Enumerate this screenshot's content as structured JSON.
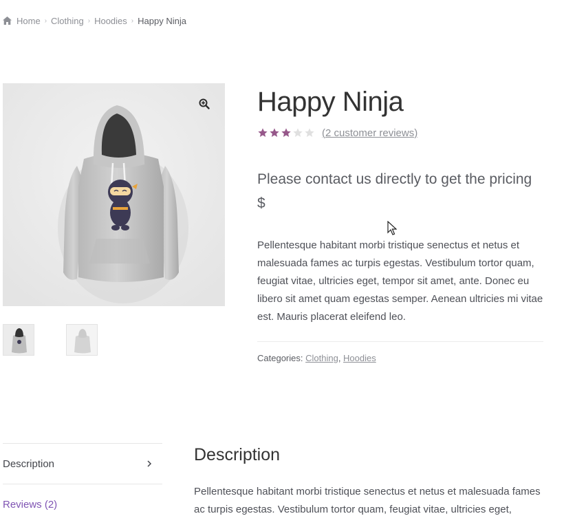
{
  "breadcrumb": {
    "home_icon": "home-icon",
    "items": [
      "Home",
      "Clothing",
      "Hoodies"
    ],
    "current": "Happy Ninja",
    "separator": "›"
  },
  "gallery": {
    "main_image_alt": "Happy Ninja hoodie",
    "zoom_icon": "zoom-icon",
    "thumbnails": [
      "hoodie-front-thumb",
      "hoodie-back-thumb"
    ]
  },
  "product": {
    "title": "Happy Ninja",
    "rating": 3,
    "rating_max": 5,
    "review_link": "(2 customer reviews)",
    "price_note": "Please contact us directly to get the pricing",
    "currency_symbol": "$",
    "short_description": "Pellentesque habitant morbi tristique senectus et netus et malesuada fames ac turpis egestas. Vestibulum tortor quam, feugiat vitae, ultricies eget, tempor sit amet, ante. Donec eu libero sit amet quam egestas semper. Aenean ultricies mi vitae est. Mauris placerat eleifend leo.",
    "categories_label": "Categories:",
    "categories": [
      "Clothing",
      "Hoodies"
    ],
    "categories_separator": ", "
  },
  "tabs": [
    {
      "label": "Description",
      "active": true
    },
    {
      "label": "Reviews (2)",
      "active": false
    }
  ],
  "description_panel": {
    "title": "Description",
    "text": "Pellentesque habitant morbi tristique senectus et netus et malesuada fames ac turpis egestas. Vestibulum tortor quam, feugiat vitae, ultricies eget,"
  },
  "colors": {
    "star_filled": "#96588a",
    "star_empty": "#e0e0e0",
    "accent_link": "#7f54b3"
  }
}
